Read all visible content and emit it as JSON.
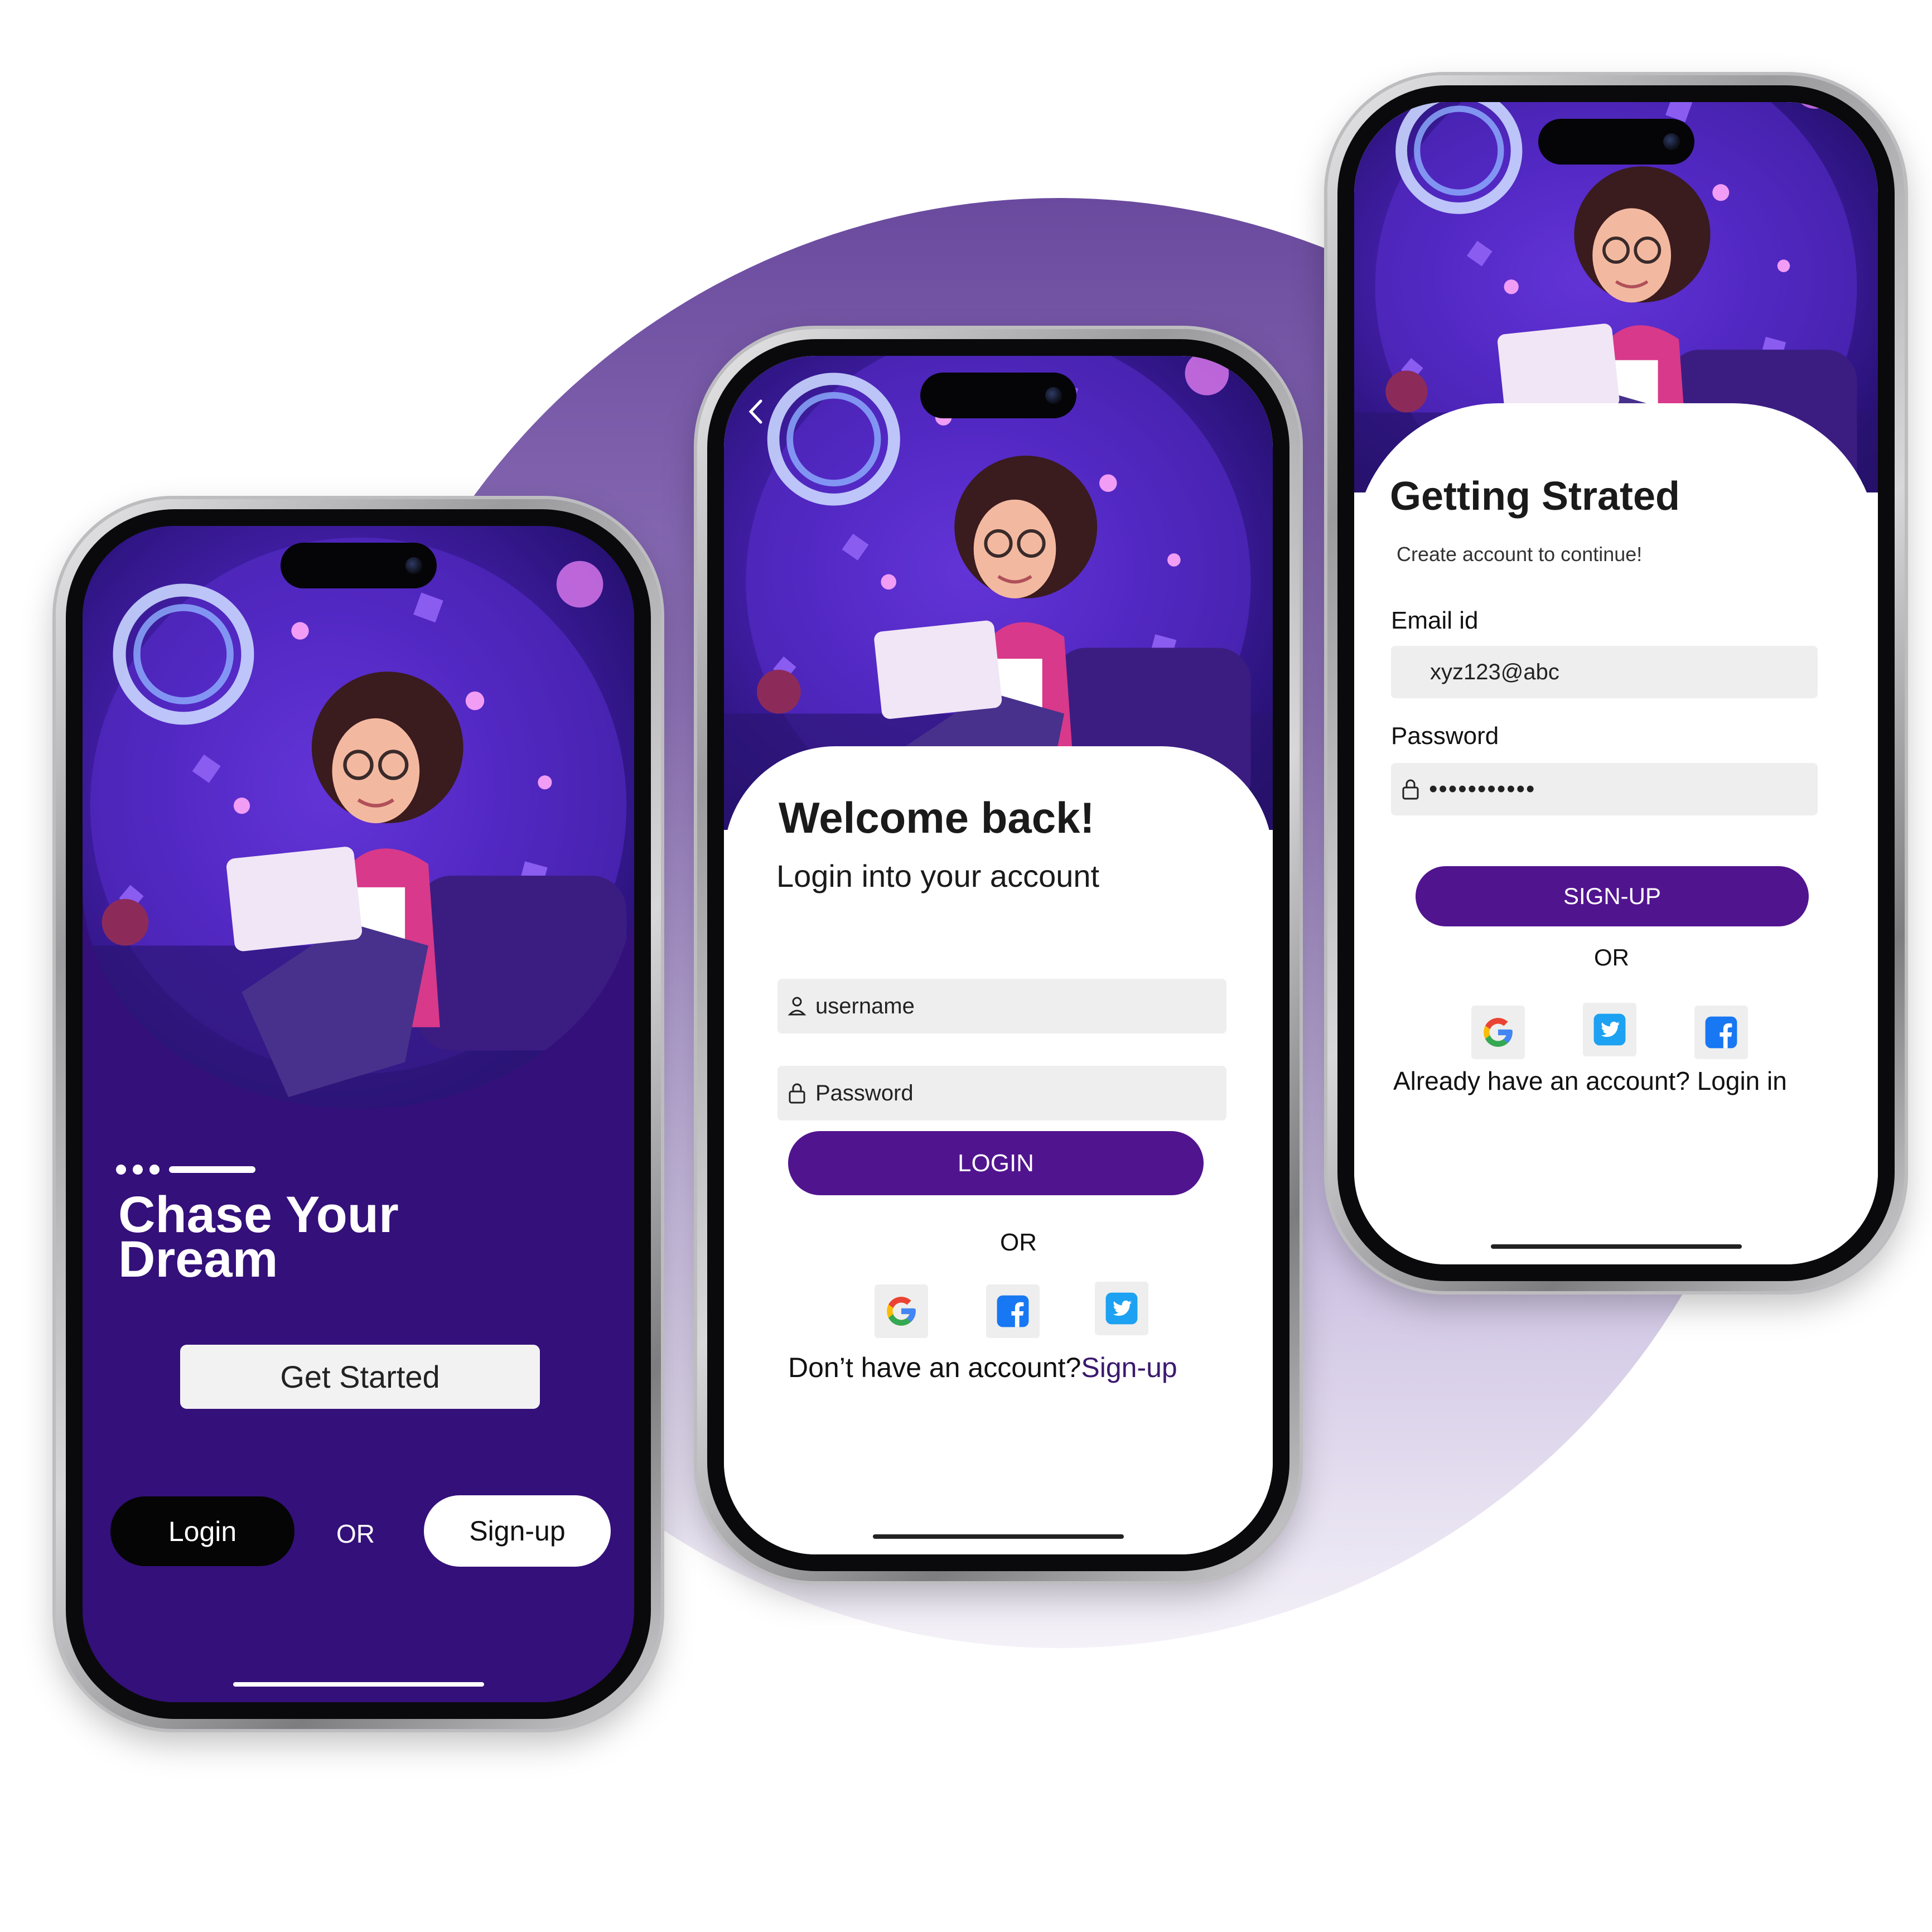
{
  "screen1": {
    "title_line1": "Chase Your",
    "title_line2": "Dream",
    "get_started_label": "Get Started",
    "login_label": "Login",
    "or_label": "OR",
    "signup_label": "Sign-up",
    "pager_dots": 3
  },
  "screen2": {
    "back_icon": "chevron-left-icon",
    "heading": "Welcome back!",
    "subheading": "Login into your account",
    "username_placeholder": "username",
    "password_placeholder": "Password",
    "login_button": "LOGIN",
    "or_label": "OR",
    "social": [
      "google-icon",
      "facebook-icon",
      "twitter-icon"
    ],
    "footer_text": "Don’t  have an account?",
    "footer_link": "Sign-up"
  },
  "screen3": {
    "heading": "Getting Strated",
    "subheading": "Create account to continue!",
    "email_label": "Email id",
    "email_value": "xyz123@abc",
    "password_label": "Password",
    "password_value": "•••••••••••",
    "signup_button": "SIGN-UP",
    "or_label": "OR",
    "social": [
      "google-icon",
      "twitter-icon",
      "facebook-icon"
    ],
    "footer_text": "Already have an account? Login in"
  },
  "colors": {
    "primary": "#51148f",
    "screen1_bg": "#34107a",
    "field_bg": "#eeeeee",
    "backdrop_top": "#6a4a9e",
    "google_blue": "#4285F4",
    "google_red": "#EA4335",
    "google_yellow": "#FBBC05",
    "google_green": "#34A853",
    "facebook_blue": "#1877F2",
    "twitter_blue": "#1DA1F2"
  }
}
